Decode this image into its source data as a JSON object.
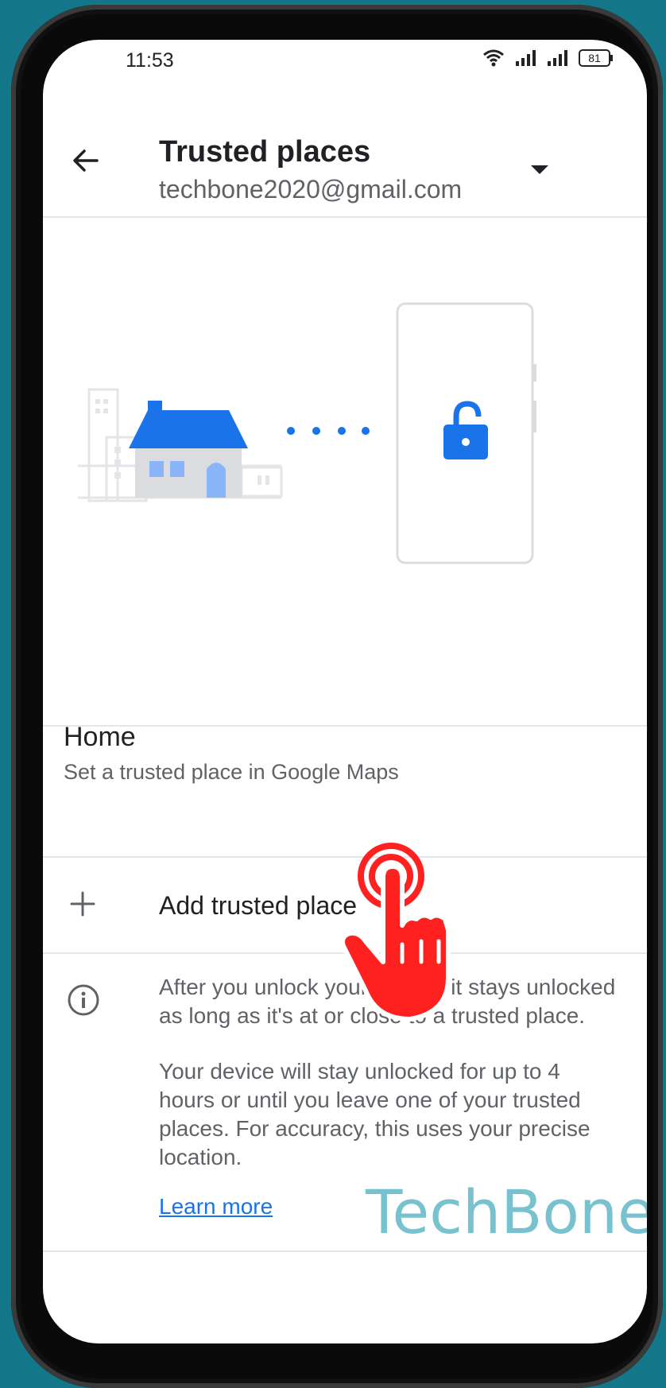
{
  "status": {
    "time": "11:53",
    "battery": "81"
  },
  "header": {
    "title": "Trusted places",
    "account": "techbone2020@gmail.com"
  },
  "home": {
    "title": "Home",
    "subtitle": "Set a trusted place in Google Maps"
  },
  "add": {
    "label": "Add trusted place"
  },
  "info": {
    "paragraph1": "After you unlock your device, it stays unlocked as long as it's at or close to a trusted place.",
    "paragraph2": "Your device will stay unlocked for up to 4 hours or until you leave one of your trusted places. For accuracy, this uses your precise location.",
    "learn_more": "Learn more"
  },
  "watermark": "TechBone",
  "colors": {
    "accent": "#1a73e8",
    "background": "#147689",
    "hand": "#ff2020"
  }
}
